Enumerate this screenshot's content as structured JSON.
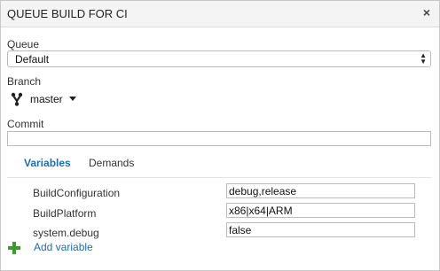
{
  "dialog": {
    "title": "QUEUE BUILD FOR CI",
    "close_icon": "close-icon",
    "close_glyph": "×"
  },
  "queue": {
    "label": "Queue",
    "selected": "Default"
  },
  "branch": {
    "label": "Branch",
    "icon": "git-branch-icon",
    "name": "master"
  },
  "commit": {
    "label": "Commit",
    "value": ""
  },
  "tabs": [
    {
      "label": "Variables",
      "active": true
    },
    {
      "label": "Demands",
      "active": false
    }
  ],
  "variables": [
    {
      "name": "BuildConfiguration",
      "value": "debug,release"
    },
    {
      "name": "BuildPlatform",
      "value": "x86|x64|ARM"
    },
    {
      "name": "system.debug",
      "value": "false"
    }
  ],
  "add_variable": {
    "icon": "plus-icon",
    "label": "Add variable"
  },
  "colors": {
    "accent": "#1e6eb5",
    "add_icon": "#3c9a2e",
    "titlebar": "#f4f4f4"
  }
}
